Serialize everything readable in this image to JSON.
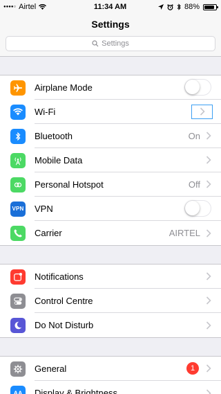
{
  "status_bar": {
    "carrier": "Airtel",
    "time": "11:34 AM",
    "battery_percent": "88%",
    "battery_level": 0.88,
    "signal_icon": "signal-dots-icon",
    "wifi_icon": "wifi-icon",
    "location_icon": "location-arrow-icon",
    "alarm_icon": "alarm-clock-icon",
    "bluetooth_icon": "bluetooth-icon"
  },
  "nav": {
    "title": "Settings"
  },
  "search": {
    "placeholder": "Settings"
  },
  "groups": [
    {
      "items": [
        {
          "label": "Airplane Mode",
          "icon": "airplane-icon",
          "color": "#ff9500",
          "accessory": "toggle",
          "toggle_on": false
        },
        {
          "label": "Wi-Fi",
          "icon": "wifi-icon",
          "color": "#1a8cff",
          "accessory": "chevron-highlighted"
        },
        {
          "label": "Bluetooth",
          "icon": "bluetooth-icon",
          "color": "#1a8cff",
          "value": "On",
          "accessory": "chevron"
        },
        {
          "label": "Mobile Data",
          "icon": "antenna-icon",
          "color": "#4cd964",
          "accessory": "chevron"
        },
        {
          "label": "Personal Hotspot",
          "icon": "hotspot-icon",
          "color": "#4cd964",
          "value": "Off",
          "accessory": "chevron"
        },
        {
          "label": "VPN",
          "icon": "vpn-icon",
          "icon_text": "VPN",
          "color": "#1a6fd8",
          "accessory": "toggle",
          "toggle_on": false
        },
        {
          "label": "Carrier",
          "icon": "phone-icon",
          "color": "#4cd964",
          "value": "AIRTEL",
          "accessory": "chevron"
        }
      ]
    },
    {
      "items": [
        {
          "label": "Notifications",
          "icon": "notifications-icon",
          "color": "#ff3b30",
          "accessory": "chevron"
        },
        {
          "label": "Control Centre",
          "icon": "control-centre-icon",
          "color": "#8e8e93",
          "accessory": "chevron"
        },
        {
          "label": "Do Not Disturb",
          "icon": "moon-icon",
          "color": "#5856d6",
          "accessory": "chevron"
        }
      ]
    },
    {
      "items": [
        {
          "label": "General",
          "icon": "gear-icon",
          "color": "#8e8e93",
          "badge": "1",
          "accessory": "chevron"
        },
        {
          "label": "Display & Brightness",
          "icon": "display-icon",
          "icon_text": "AA",
          "color": "#1a8cff",
          "accessory": "chevron"
        }
      ]
    }
  ]
}
